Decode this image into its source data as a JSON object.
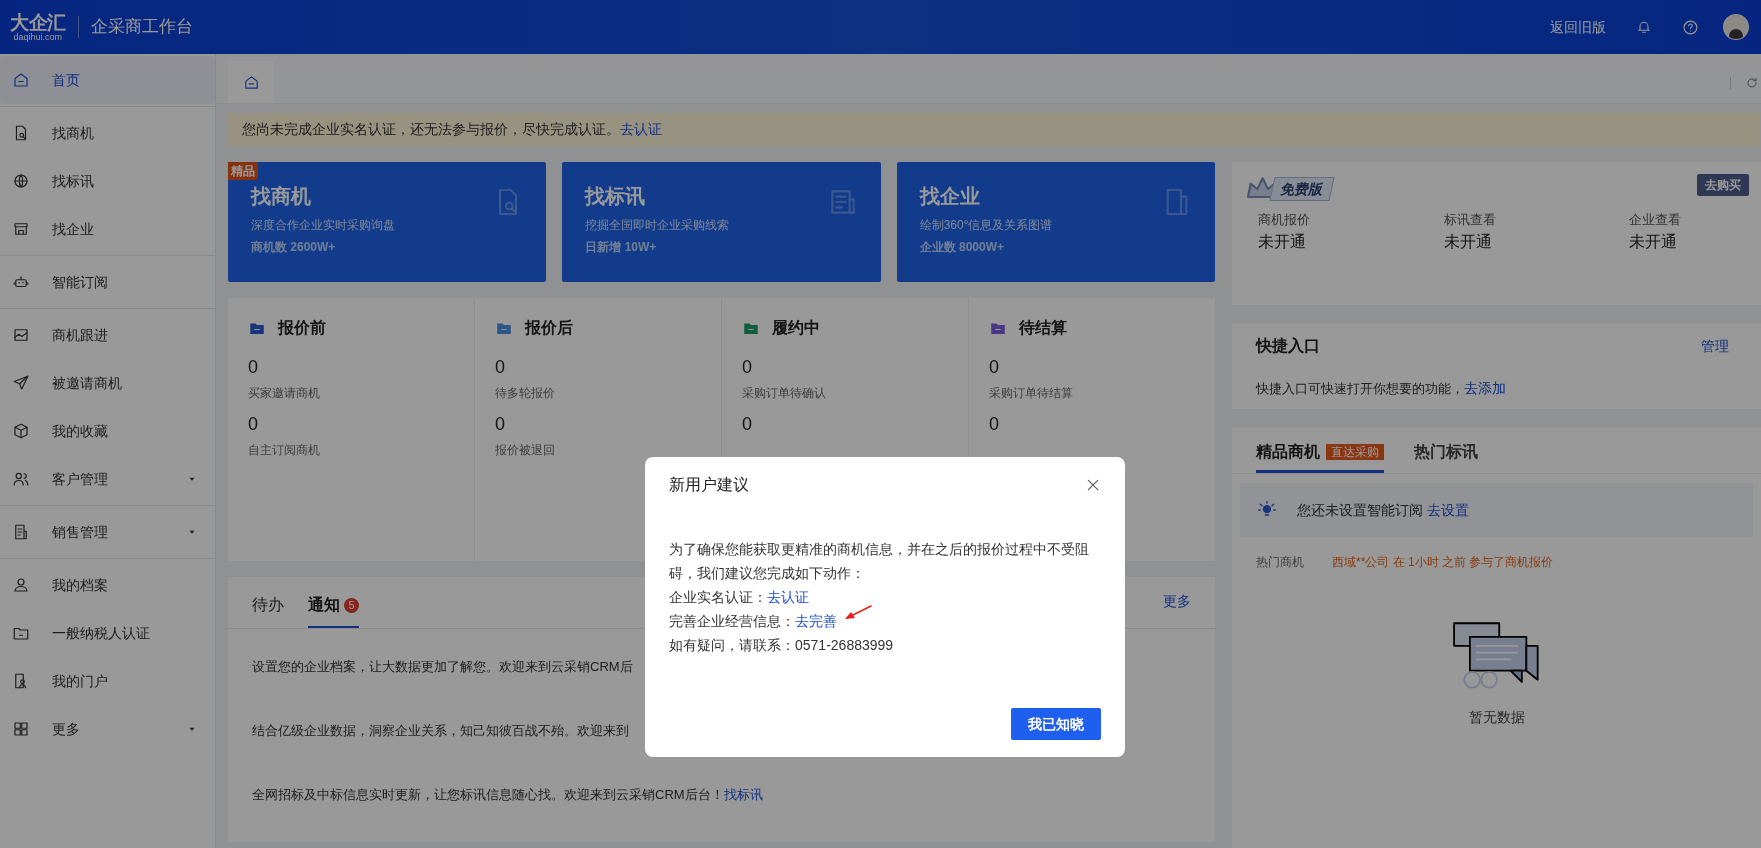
{
  "header": {
    "logo": "大企汇",
    "logo_sub": "daqihui.com",
    "title": "企采商工作台",
    "back_link": "返回旧版"
  },
  "sidebar": {
    "groups": [
      [
        {
          "label": "首页",
          "selected": true,
          "expandable": false
        }
      ],
      [
        {
          "label": "找商机",
          "selected": false,
          "expandable": false
        },
        {
          "label": "找标讯",
          "selected": false,
          "expandable": false
        },
        {
          "label": "找企业",
          "selected": false,
          "expandable": false
        }
      ],
      [
        {
          "label": "智能订阅",
          "selected": false,
          "expandable": false
        }
      ],
      [
        {
          "label": "商机跟进",
          "selected": false,
          "expandable": false
        },
        {
          "label": "被邀请商机",
          "selected": false,
          "expandable": false
        },
        {
          "label": "我的收藏",
          "selected": false,
          "expandable": false
        },
        {
          "label": "客户管理",
          "selected": false,
          "expandable": true
        }
      ],
      [
        {
          "label": "销售管理",
          "selected": false,
          "expandable": true
        }
      ],
      [
        {
          "label": "我的档案",
          "selected": false,
          "expandable": false
        },
        {
          "label": "一般纳税人认证",
          "selected": false,
          "expandable": false
        },
        {
          "label": "我的门户",
          "selected": false,
          "expandable": false
        },
        {
          "label": "更多",
          "selected": false,
          "expandable": true
        }
      ]
    ]
  },
  "alert": {
    "text": "您尚未完成企业实名认证，还无法参与报价，尽快完成认证。",
    "link": "去认证"
  },
  "feature_cards": [
    {
      "title": "找商机",
      "subtitle": "深度合作企业实时采购询盘",
      "stat": "商机数 2600W+",
      "badge": "精品"
    },
    {
      "title": "找标讯",
      "subtitle": "挖掘全国即时企业采购线索",
      "stat": "日新增 10W+"
    },
    {
      "title": "找企业",
      "subtitle": "绘制360°信息及关系图谱",
      "stat": "企业数 8000W+"
    }
  ],
  "stages": [
    {
      "title": "报价前",
      "items": [
        {
          "value": "0",
          "label": "买家邀请商机"
        },
        {
          "value": "0",
          "label": "自主订阅商机"
        }
      ]
    },
    {
      "title": "报价后",
      "items": [
        {
          "value": "0",
          "label": "待多轮报价"
        },
        {
          "value": "0",
          "label": "报价被退回"
        }
      ]
    },
    {
      "title": "履约中",
      "items": [
        {
          "value": "0",
          "label": "采购订单待确认"
        },
        {
          "value": "0"
        }
      ]
    },
    {
      "title": "待结算",
      "items": [
        {
          "value": "0",
          "label": "采购订单待结算"
        },
        {
          "value": "0"
        }
      ]
    }
  ],
  "todo": {
    "tabs": [
      {
        "label": "待办",
        "selected": false
      },
      {
        "label": "通知",
        "count": "5",
        "selected": true
      }
    ],
    "more": "更多",
    "rows": [
      {
        "text": "设置您的企业档案，让大数据更加了解您。欢迎来到云采销CRM后"
      },
      {
        "text": "结合亿级企业数据，洞察企业关系，知己知彼百战不殆。欢迎来到"
      },
      {
        "text": "全网招标及中标信息实时更新，让您标讯信息随心找。欢迎来到云采销CRM后台！",
        "link": "找标讯"
      }
    ]
  },
  "plan": {
    "badge": "免费版",
    "buy": "去购买",
    "items": [
      {
        "label": "商机报价",
        "value": "未开通"
      },
      {
        "label": "标讯查看",
        "value": "未开通"
      },
      {
        "label": "企业查看",
        "value": "未开通"
      }
    ]
  },
  "quick_entry": {
    "title": "快捷入口",
    "manage": "管理",
    "text": "快捷入口可快速打开你想要的功能，",
    "link": "去添加"
  },
  "recommend": {
    "tabs": [
      {
        "label": "精品商机",
        "tag": "直达采购",
        "selected": true
      },
      {
        "label": "热门标讯",
        "selected": false
      }
    ],
    "tip": "您还未设置智能订阅",
    "tip_link": "去设置",
    "hot_label": "热门商机",
    "hot_text": "西域**公司 在 1小时 之前 参与了商机报价",
    "empty": "暂无数据"
  },
  "modal": {
    "title": "新用户建议",
    "intro": "为了确保您能获取更精准的商机信息，并在之后的报价过程中不受阻碍，我们建议您完成如下动作：",
    "actions": [
      {
        "label": "企业实名认证：",
        "link": "去认证"
      },
      {
        "label": "完善企业经营信息：",
        "link": "去完善"
      }
    ],
    "contact": "如有疑问，请联系：0571-26883999",
    "button": "我已知晓"
  }
}
